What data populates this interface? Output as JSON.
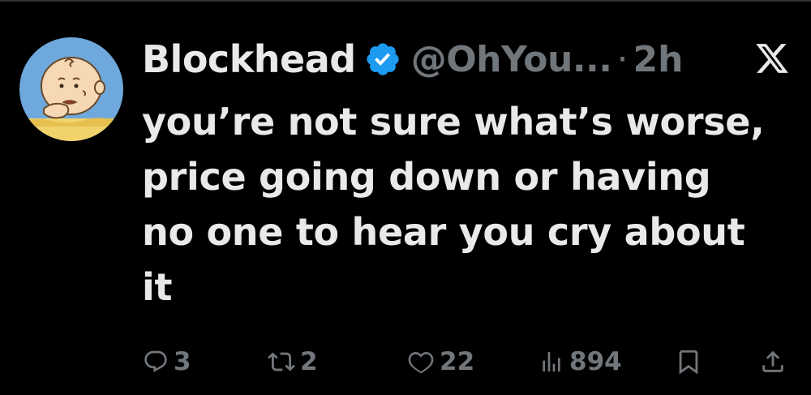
{
  "author": {
    "display_name": "Blockhead",
    "handle": "@OhYou...",
    "separator": "·",
    "time": "2h"
  },
  "tweet": {
    "lines": [
      "you’re not sure what’s worse,",
      "price going down or having",
      "no one to hear you cry about",
      "it"
    ]
  },
  "actions": {
    "replies": "3",
    "reposts": "2",
    "likes": "22",
    "views": "894"
  },
  "icons": {
    "avatar": "charlie-brown-avatar",
    "verified": "verified-badge-icon",
    "menu": "x-logo-icon",
    "reply": "reply-icon",
    "repost": "repost-icon",
    "like": "heart-icon",
    "views": "views-chart-icon",
    "bookmark": "bookmark-icon",
    "share": "share-icon"
  },
  "colors": {
    "background": "#000000",
    "text": "#e7e9ea",
    "muted": "#71767b",
    "verified": "#1d9bf0"
  }
}
